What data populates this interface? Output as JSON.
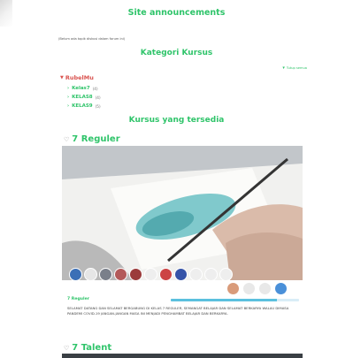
{
  "site_announcements": {
    "title": "Site announcements",
    "note": "(Belum ada topik diskusi dalam forum ini)"
  },
  "categories": {
    "title": "Kategori Kursus",
    "collapse_all": "Tutup semua",
    "root": "RubelMu",
    "items": [
      {
        "label": "Kelas7",
        "count": "(4)"
      },
      {
        "label": "KELAS8",
        "count": "(4)"
      },
      {
        "label": "KELAS9",
        "count": "(5)"
      }
    ]
  },
  "courses": {
    "title": "Kursus yang tersedia",
    "list": [
      {
        "name": "7 Reguler",
        "card_name": "7 Reguler",
        "progress": 0.83,
        "summary": "Selamat datang dan selamat bergabung di kelas 7 Reguler, semangat belajar dan selamat berkarya walau dimasa pandemi covid-19 jangan-jangan masa ini menjadi penghambat belajar dan berkarya."
      },
      {
        "name": "7 Talent"
      }
    ]
  },
  "avatar_colors": [
    "#3b6fb6",
    "#e6e6e6",
    "#7a7f8a",
    "#b35a5a",
    "#9b3b3b",
    "#eeeeee",
    "#c44",
    "#3553a8",
    "#eeeeee",
    "#eeeeee",
    "#eeeeee"
  ],
  "avatar_colors_row2": [
    "#d99b7a",
    "#e8e8e8",
    "#e8e8e8",
    "#4a90d9"
  ]
}
